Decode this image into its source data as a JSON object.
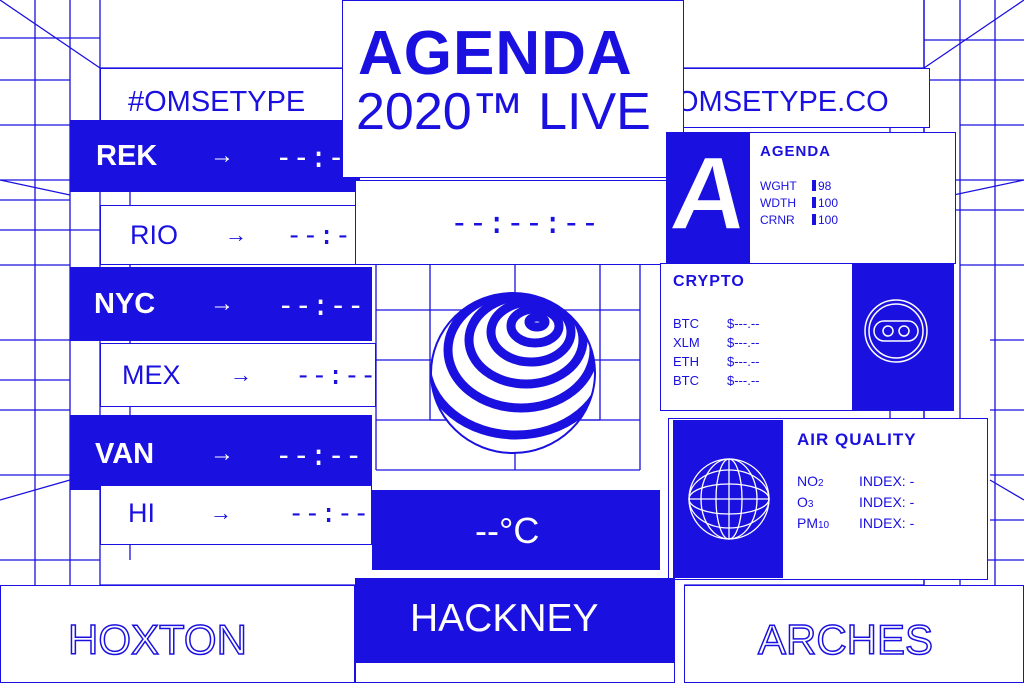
{
  "colors": {
    "accent": "#1a10e0",
    "background": "#ffffff"
  },
  "header": {
    "title": "AGENDA",
    "subtitle": "2020™ LIVE"
  },
  "hashtag": "#OMSETYPE",
  "website": "OMSETYPE.CO",
  "clock": "--:--:--",
  "arrow_glyph": "→",
  "cities": [
    {
      "code": "REK",
      "time": "--:--"
    },
    {
      "code": "RIO",
      "time": "--:--"
    },
    {
      "code": "NYC",
      "time": "--:--"
    },
    {
      "code": "MEX",
      "time": "--:--"
    },
    {
      "code": "VAN",
      "time": "--:--"
    },
    {
      "code": "HI",
      "time": "--:--"
    }
  ],
  "font_panel": {
    "title": "AGENDA",
    "glyph": "A",
    "axes": [
      {
        "label": "WGHT",
        "value": "98"
      },
      {
        "label": "WDTH",
        "value": "100"
      },
      {
        "label": "CRNR",
        "value": "100"
      }
    ]
  },
  "crypto": {
    "title": "CRYPTO",
    "coins": [
      {
        "symbol": "BTC",
        "price": "$---.--"
      },
      {
        "symbol": "XLM",
        "price": "$---.--"
      },
      {
        "symbol": "ETH",
        "price": "$---.--"
      },
      {
        "symbol": "BTC",
        "price": "$---.--"
      }
    ],
    "icon": "coin-icon"
  },
  "air_quality": {
    "title": "AIR QUALITY",
    "icon": "globe-icon",
    "rows": [
      {
        "pollutant": "NO",
        "sub": "2",
        "index": "INDEX: -"
      },
      {
        "pollutant": "O",
        "sub": "3",
        "index": "INDEX: -"
      },
      {
        "pollutant": "PM",
        "sub": "10",
        "index": "INDEX: -"
      }
    ]
  },
  "temperature": "--°C",
  "locations": {
    "left": "HOXTON",
    "center": "HACKNEY",
    "right": "ARCHES"
  },
  "sphere_icon": "striped-sphere-icon"
}
